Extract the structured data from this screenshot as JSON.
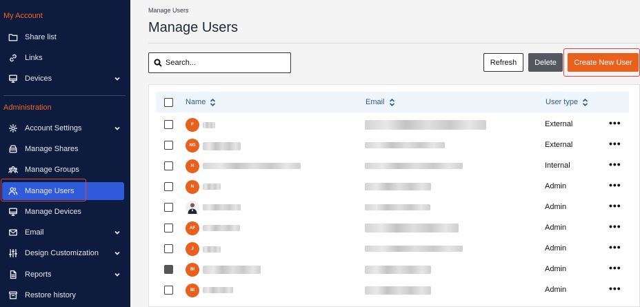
{
  "sidebar": {
    "sections": [
      {
        "title": "My Account"
      },
      {
        "title": "Administration"
      }
    ],
    "items": [
      {
        "label": "Share list"
      },
      {
        "label": "Links"
      },
      {
        "label": "Devices"
      },
      {
        "label": "Account Settings"
      },
      {
        "label": "Manage Shares"
      },
      {
        "label": "Manage Groups"
      },
      {
        "label": "Manage Users"
      },
      {
        "label": "Manage Devices"
      },
      {
        "label": "Email"
      },
      {
        "label": "Design Customization"
      },
      {
        "label": "Reports"
      },
      {
        "label": "Restore history"
      }
    ]
  },
  "page": {
    "breadcrumb": "Manage Users",
    "title": "Manage Users"
  },
  "toolbar": {
    "search_placeholder": "Search...",
    "refresh_label": "Refresh",
    "delete_label": "Delete",
    "create_label": "Create New User"
  },
  "table": {
    "columns": [
      "Name",
      "Email",
      "User type"
    ],
    "rows": [
      {
        "initials": "F",
        "user_type": "External",
        "checked": false
      },
      {
        "initials": "NG",
        "user_type": "External",
        "checked": false
      },
      {
        "initials": "H",
        "user_type": "Internal",
        "checked": false
      },
      {
        "initials": "N",
        "user_type": "Admin",
        "checked": false
      },
      {
        "initials": "",
        "user_type": "Admin",
        "checked": false
      },
      {
        "initials": "AF",
        "user_type": "Admin",
        "checked": false
      },
      {
        "initials": "J",
        "user_type": "Admin",
        "checked": false
      },
      {
        "initials": "BI",
        "user_type": "Admin",
        "checked": true
      },
      {
        "initials": "BI",
        "user_type": "Admin",
        "checked": false
      }
    ],
    "row_action": "•••"
  },
  "colors": {
    "sidebar_bg": "#0d1b3e",
    "accent": "#e8601c",
    "active_nav": "#2f5bdb",
    "highlight": "#e0453b"
  }
}
